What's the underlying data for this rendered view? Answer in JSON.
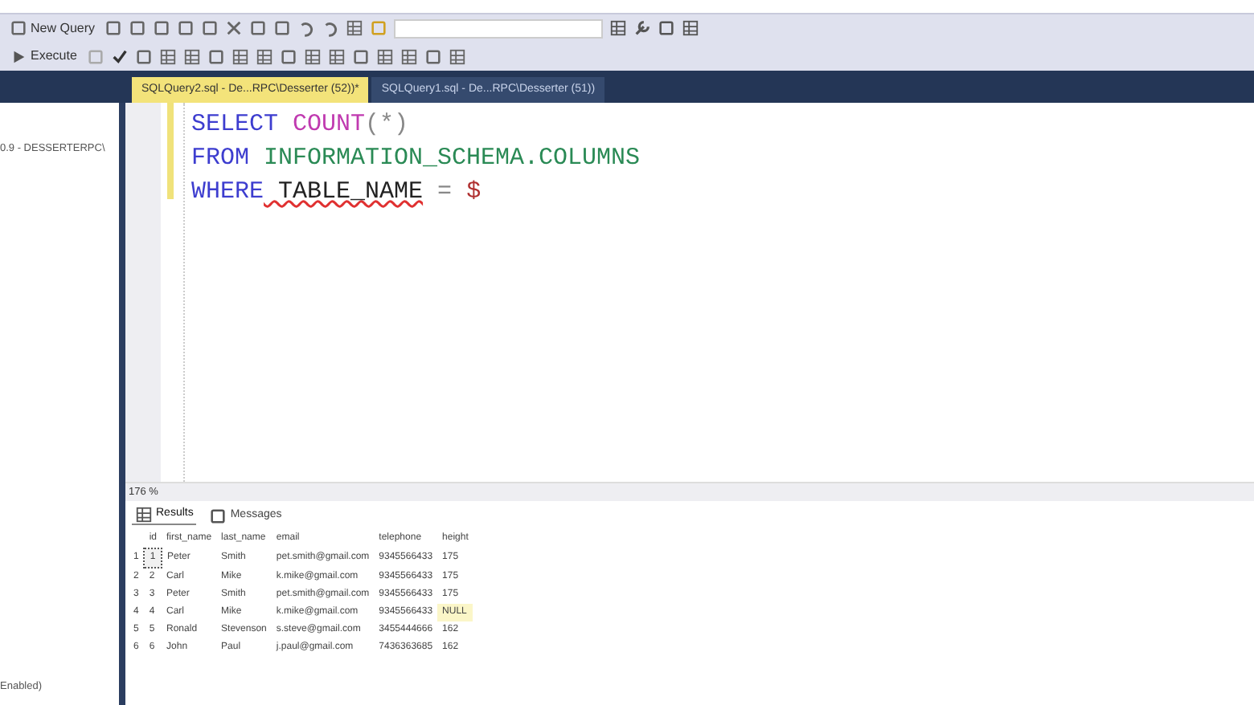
{
  "toolbar_1": {
    "new_query": "New Query"
  },
  "toolbar_2": {
    "execute": "Execute"
  },
  "tabs": [
    {
      "label": "SQLQuery2.sql - De...RPC\\Desserter (52))*",
      "selected": true
    },
    {
      "label": "SQLQuery1.sql - De...RPC\\Desserter (51))",
      "selected": false
    }
  ],
  "object_explorer": {
    "server": "0.9 - DESSERTERPC\\",
    "status": "Enabled)"
  },
  "editor": {
    "lines": [
      [
        {
          "text": "SELECT",
          "kind": "keyword",
          "error": false
        },
        {
          "text": " COUNT",
          "kind": "function",
          "error": false
        },
        {
          "text": "(*)",
          "kind": "operator",
          "error": false
        }
      ],
      [
        {
          "text": "FROM",
          "kind": "keyword",
          "error": false
        },
        {
          "text": " INFORMATION_SCHEMA.COLUMNS",
          "kind": "system",
          "error": false
        }
      ],
      [
        {
          "text": "WHERE",
          "kind": "keyword",
          "error": false
        },
        {
          "text": " TABLE_NAME",
          "kind": "plain",
          "error": true
        },
        {
          "text": " =",
          "kind": "operator",
          "error": false
        },
        {
          "text": " $",
          "kind": "string",
          "error": false
        }
      ]
    ]
  },
  "zoom_level": "176 %",
  "result_tabs": [
    {
      "label": "Results",
      "selected": true
    },
    {
      "label": "Messages",
      "selected": false
    }
  ],
  "table": {
    "columns": [
      "id",
      "first_name",
      "last_name",
      "email",
      "telephone",
      "height"
    ],
    "rows": [
      {
        "number": "1",
        "selected": true,
        "cells": [
          {
            "text": "1",
            "kind": "value"
          },
          {
            "text": "Peter",
            "kind": "value"
          },
          {
            "text": "Smith",
            "kind": "value"
          },
          {
            "text": "pet.smith@gmail.com",
            "kind": "value"
          },
          {
            "text": "9345566433",
            "kind": "value"
          },
          {
            "text": "175",
            "kind": "value"
          }
        ]
      },
      {
        "number": "2",
        "selected": false,
        "cells": [
          {
            "text": "2",
            "kind": "value"
          },
          {
            "text": "Carl",
            "kind": "value"
          },
          {
            "text": "Mike",
            "kind": "value"
          },
          {
            "text": "k.mike@gmail.com",
            "kind": "value"
          },
          {
            "text": "9345566433",
            "kind": "value"
          },
          {
            "text": "175",
            "kind": "value"
          }
        ]
      },
      {
        "number": "3",
        "selected": false,
        "cells": [
          {
            "text": "3",
            "kind": "value"
          },
          {
            "text": "Peter",
            "kind": "value"
          },
          {
            "text": "Smith",
            "kind": "value"
          },
          {
            "text": "pet.smith@gmail.com",
            "kind": "value"
          },
          {
            "text": "9345566433",
            "kind": "value"
          },
          {
            "text": "175",
            "kind": "value"
          }
        ]
      },
      {
        "number": "4",
        "selected": false,
        "cells": [
          {
            "text": "4",
            "kind": "value"
          },
          {
            "text": "Carl",
            "kind": "value"
          },
          {
            "text": "Mike",
            "kind": "value"
          },
          {
            "text": "k.mike@gmail.com",
            "kind": "value"
          },
          {
            "text": "9345566433",
            "kind": "value"
          },
          {
            "text": "NULL",
            "kind": "null"
          }
        ]
      },
      {
        "number": "5",
        "selected": false,
        "cells": [
          {
            "text": "5",
            "kind": "value"
          },
          {
            "text": "Ronald",
            "kind": "value"
          },
          {
            "text": "Stevenson",
            "kind": "value"
          },
          {
            "text": "s.steve@gmail.com",
            "kind": "value"
          },
          {
            "text": "3455444666",
            "kind": "value"
          },
          {
            "text": "162",
            "kind": "value"
          }
        ]
      },
      {
        "number": "6",
        "selected": false,
        "cells": [
          {
            "text": "6",
            "kind": "value"
          },
          {
            "text": "John",
            "kind": "value"
          },
          {
            "text": "Paul",
            "kind": "value"
          },
          {
            "text": "j.paul@gmail.com",
            "kind": "value"
          },
          {
            "text": "7436363685",
            "kind": "value"
          },
          {
            "text": "162",
            "kind": "value"
          }
        ]
      }
    ]
  }
}
